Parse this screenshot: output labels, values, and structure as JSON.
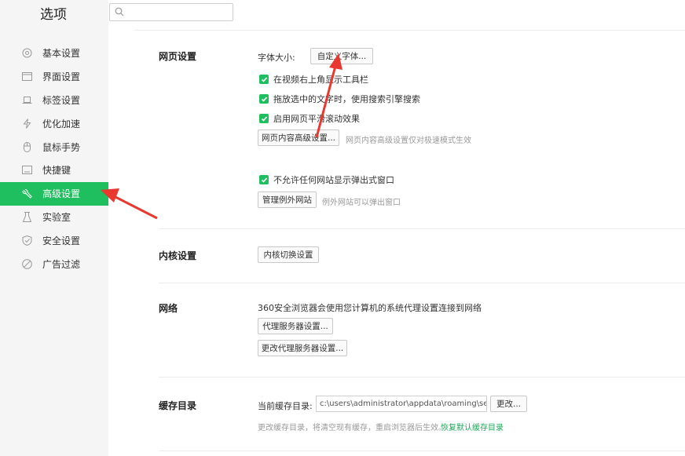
{
  "app": {
    "title": "选项"
  },
  "search": {
    "placeholder": ""
  },
  "sidebar": {
    "items": [
      {
        "label": "基本设置",
        "icon": "settings-circle-icon"
      },
      {
        "label": "界面设置",
        "icon": "window-icon"
      },
      {
        "label": "标签设置",
        "icon": "tab-icon"
      },
      {
        "label": "优化加速",
        "icon": "lightning-icon"
      },
      {
        "label": "鼠标手势",
        "icon": "mouse-icon"
      },
      {
        "label": "快捷键",
        "icon": "keyboard-icon"
      },
      {
        "label": "高级设置",
        "icon": "wrench-icon",
        "active": true
      },
      {
        "label": "实验室",
        "icon": "flask-icon"
      },
      {
        "label": "安全设置",
        "icon": "shield-icon"
      },
      {
        "label": "广告过滤",
        "icon": "block-icon"
      }
    ]
  },
  "web_settings": {
    "title": "网页设置",
    "font_size_label": "字体大小:",
    "custom_font_button": "自定义字体...",
    "options": [
      {
        "label": "在视频右上角显示工具栏",
        "checked": true
      },
      {
        "label": "拖放选中的文字时，使用搜索引擎搜索",
        "checked": true
      },
      {
        "label": "启用网页平滑滚动效果",
        "checked": true
      }
    ],
    "advanced_button": "网页内容高级设置...",
    "advanced_hint": "网页内容高级设置仅对极速模式生效",
    "popup_option": {
      "label": "不允许任何网站显示弹出式窗口",
      "checked": true
    },
    "exceptions_button": "管理例外网站",
    "exceptions_hint": "例外网站可以弹出窗口"
  },
  "kernel_settings": {
    "title": "内核设置",
    "switch_button": "内核切换设置"
  },
  "network": {
    "title": "网络",
    "description": "360安全浏览器会使用您计算机的系统代理设置连接到网络",
    "proxy_button": "代理服务器设置...",
    "change_proxy_button": "更改代理服务器设置..."
  },
  "cache": {
    "title": "缓存目录",
    "current_label": "当前缓存目录:",
    "path": "c:\\users\\administrator\\appdata\\roaming\\secore",
    "change_button": "更改...",
    "hint": "更改缓存目录，将清空现有缓存，重启浏览器后生效。",
    "restore_link": "恢复默认缓存目录"
  },
  "colors": {
    "accent": "#1fbf5f",
    "arrow": "#e8382f"
  }
}
